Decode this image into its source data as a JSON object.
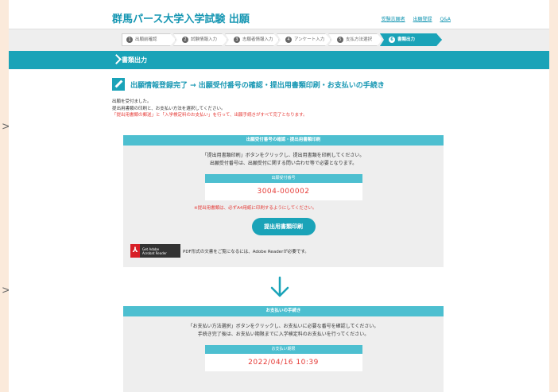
{
  "header": {
    "title": "群馬パース大学入学試験 出願",
    "links": [
      "受験志願者",
      "出願登録",
      "Q&A"
    ]
  },
  "steps": [
    {
      "num": "1",
      "label": "出願前確認"
    },
    {
      "num": "2",
      "label": "試験情報入力"
    },
    {
      "num": "3",
      "label": "志願者情報入力"
    },
    {
      "num": "4",
      "label": "アンケート入力"
    },
    {
      "num": "5",
      "label": "支払方法選択"
    },
    {
      "num": "6",
      "label": "書類出力"
    }
  ],
  "active_step": 6,
  "section_title": "書類出力",
  "complete": {
    "title": "出願情報登録完了 → 出願受付番号の確認・提出用書類印刷・お支払いの手続き",
    "line1": "出願を受付ました。",
    "line2": "提出用書類の印刷と、お支払い方法を選択してください。",
    "line3": "「提出用書類の郵送」と「入学検定料のお支払い」を行って、出願手続きがすべて完了となります。"
  },
  "print_box": {
    "head": "出願受付番号の確認・提出用書類印刷",
    "text1": "「提出用書類印刷」ボタンをクリックし、提出用書類を印刷してください。",
    "text2": "出願受付番号は、出願受付に関する問い合わせ等で必要となります。",
    "number_label": "出願受付番号",
    "number_value": "3004-000002",
    "warn": "※提出用書類は、必ずA4用紙に印刷するようにしてください。",
    "button": "提出用書類印刷",
    "adobe_badge_line1": "Get Adobe",
    "adobe_badge_line2": "Acrobat Reader",
    "adobe_note": "PDF形式の文書をご覧になるには、Adobe Readerが必要です。"
  },
  "pay_box": {
    "head": "お支払いの手続き",
    "text1": "「お支払い方法選択」ボタンをクリックし、お支払いに必要な番号を確認してください。",
    "text2": "手続き完了後は、お支払い期限までに入学検定料のお支払いを行ってください。",
    "deadline_label": "お支払い期限",
    "deadline_value": "2022/04/16 10:39"
  },
  "colors": {
    "accent": "#1aa3b8",
    "accent_light": "#4dbfd0",
    "warn": "#e53935",
    "outer_bg": "#fbeadb"
  }
}
